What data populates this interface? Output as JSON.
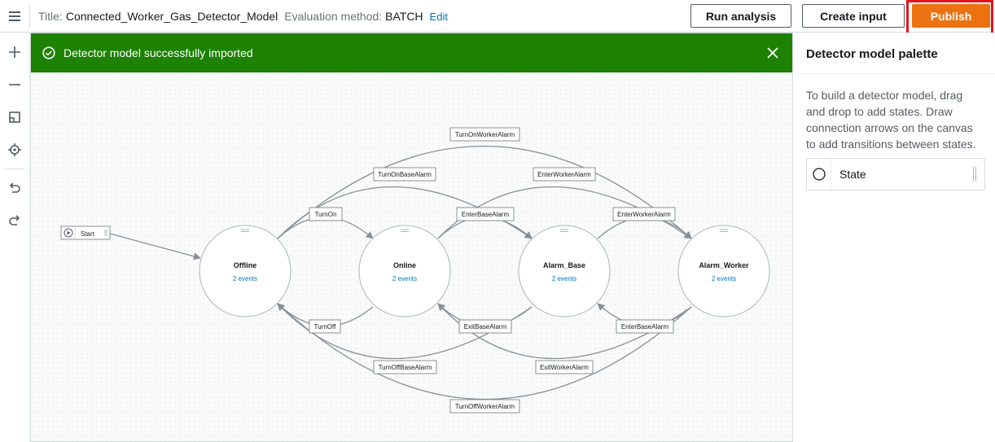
{
  "header": {
    "title_label": "Title:",
    "title_value": "Connected_Worker_Gas_Detector_Model",
    "eval_label": "Evaluation method:",
    "eval_value": "BATCH",
    "edit_link": "Edit",
    "run_analysis": "Run analysis",
    "create_input": "Create input",
    "publish": "Publish"
  },
  "toolbar": {
    "items": [
      "zoom-in-icon",
      "zoom-out-icon",
      "fit-to-screen-icon",
      "recenter-icon",
      "undo-icon",
      "redo-icon"
    ]
  },
  "banner": {
    "message": "Detector model successfully imported",
    "color": "#1d8102"
  },
  "diagram": {
    "start_label": "Start",
    "states": [
      {
        "name": "Offline",
        "events": "2 events"
      },
      {
        "name": "Online",
        "events": "2 events"
      },
      {
        "name": "Alarm_Base",
        "events": "2 events"
      },
      {
        "name": "Alarm_Worker",
        "events": "2 events"
      }
    ],
    "transitions": {
      "turn_on_worker_alarm": "TurnOnWorkerAlarm",
      "turn_on_base_alarm": "TurnOnBaseAlarm",
      "enter_worker_alarm_top": "EnterWorkerAlarm",
      "turn_on": "TurnOn",
      "enter_base_alarm_top": "EnterBaseAlarm",
      "enter_worker_alarm_right": "EnterWorkerAlarm",
      "turn_off": "TurnOff",
      "exit_base_alarm": "ExitBaseAlarm",
      "enter_base_alarm_bottom": "EnterBaseAlarm",
      "turn_off_base_alarm": "TurnOffBaseAlarm",
      "exit_worker_alarm": "ExitWorkerAlarm",
      "turn_off_worker_alarm": "TurnOffWorkerAlarm"
    }
  },
  "palette": {
    "title": "Detector model palette",
    "description": "To build a detector model, drag and drop to add states. Draw connection arrows on the canvas to add transitions between states.",
    "item_label": "State"
  },
  "colors": {
    "accent": "#ec7211",
    "highlight": "#e3141e",
    "link": "#0073bb"
  }
}
